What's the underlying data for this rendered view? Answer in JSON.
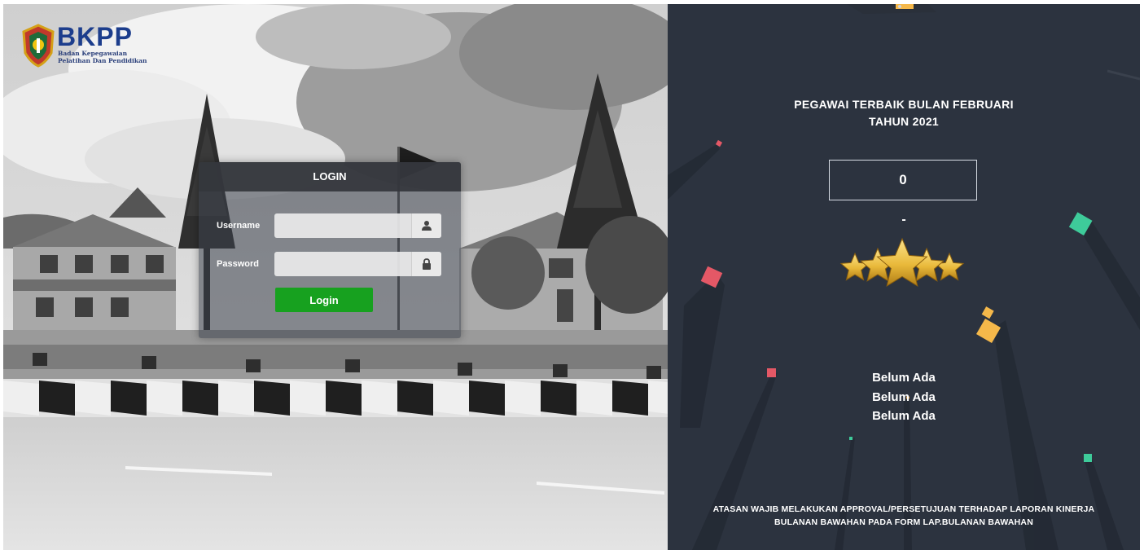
{
  "brand": {
    "name": "BKPP",
    "subtitle_line1": "Badan Kepegawaian",
    "subtitle_line2": "Pelatihan Dan Pendidikan"
  },
  "login": {
    "header": "LOGIN",
    "username_label": "Username",
    "username_value": "",
    "password_label": "Password",
    "password_value": "",
    "button_label": "Login"
  },
  "employee": {
    "title_line1": "PEGAWAI TERBAIK BULAN FEBRUARI",
    "title_line2": "TAHUN 2021",
    "score": "0",
    "dash": "-",
    "stars": 5,
    "names": [
      "Belum Ada",
      "Belum Ada",
      "Belum Ada"
    ]
  },
  "notice": {
    "line1": "ATASAN WAJIB MELAKUKAN APPROVAL/PERSETUJUAN TERHADAP LAPORAN KINERJA",
    "line2": "BULANAN BAWAHAN PADA FORM LAP.BULANAN BAWAHAN"
  },
  "colors": {
    "login_button": "#17a11f",
    "right_panel_bg": "#2c333f",
    "brand_blue": "#1c3d8c",
    "star_gold": "#e9b93a"
  },
  "icons": {
    "username": "user-icon",
    "password": "lock-icon",
    "logo": "crest-icon",
    "rating": "star-icon"
  }
}
